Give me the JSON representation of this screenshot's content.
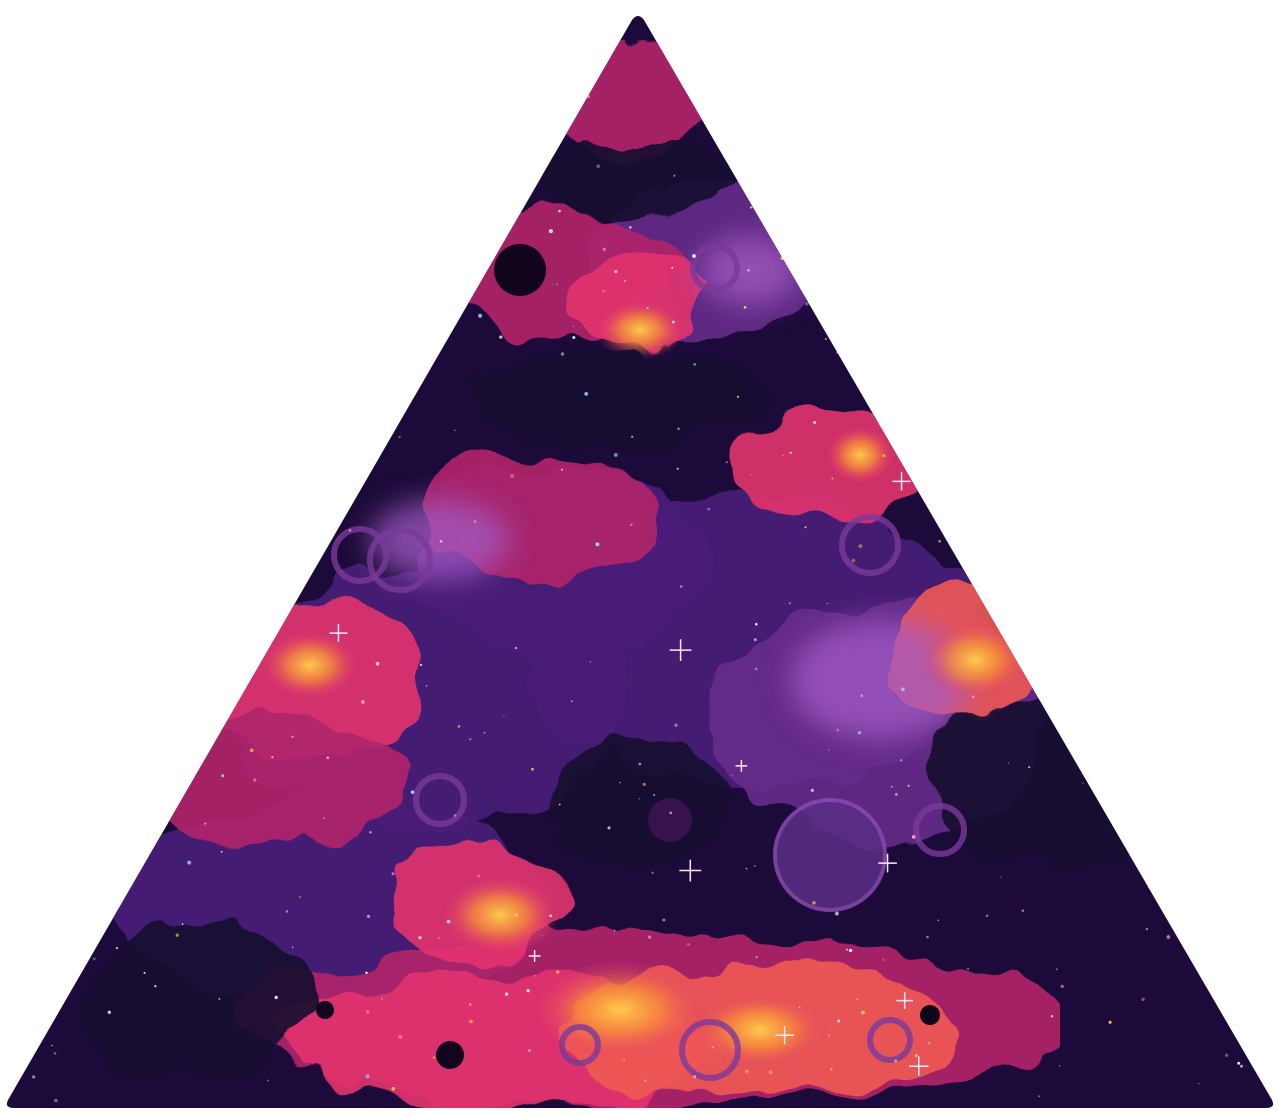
{
  "image": {
    "subject": "triangle-cosmic-nebula",
    "palette": {
      "background": "#ffffff",
      "deep_space": "#1c0b3a",
      "dark_violet": "#2a0f4f",
      "violet": "#4a1f7a",
      "purple": "#6a2e8f",
      "magenta": "#b0246a",
      "pink": "#e2356e",
      "coral": "#f05a55",
      "orange": "#f7913a",
      "yellow": "#ffd24a",
      "lavender": "#a35bc4"
    }
  }
}
